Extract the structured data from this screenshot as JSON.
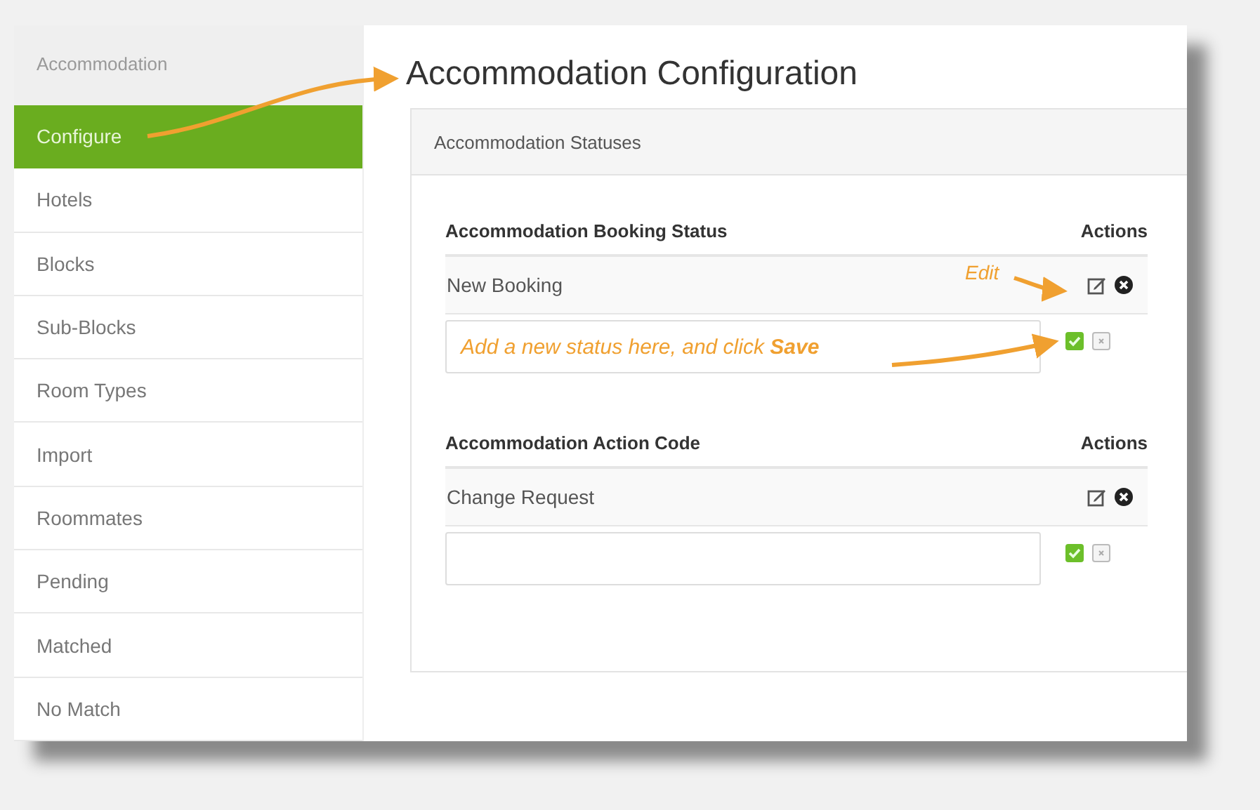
{
  "sidebar": {
    "header": "Accommodation",
    "items": [
      {
        "label": "Configure",
        "selected": true
      },
      {
        "label": "Hotels",
        "selected": false
      },
      {
        "label": "Blocks",
        "selected": false
      },
      {
        "label": "Sub-Blocks",
        "selected": false
      },
      {
        "label": "Room Types",
        "selected": false
      },
      {
        "label": "Import",
        "selected": false
      },
      {
        "label": "Roommates",
        "selected": false
      },
      {
        "label": "Pending",
        "selected": false
      },
      {
        "label": "Matched",
        "selected": false
      },
      {
        "label": "No Match",
        "selected": false
      }
    ]
  },
  "page_title": "Accommodation Configuration",
  "panel": {
    "title": "Accommodation Statuses",
    "sections": [
      {
        "heading": "Accommodation Booking Status",
        "actions_heading": "Actions",
        "rows": [
          {
            "text": "New Booking",
            "annotation": "Edit"
          }
        ],
        "new_entry_annotation": "Add a new status here, and click **Save**"
      },
      {
        "heading": "Accommodation Action Code",
        "actions_heading": "Actions",
        "rows": [
          {
            "text": "Change Request"
          }
        ]
      }
    ]
  }
}
